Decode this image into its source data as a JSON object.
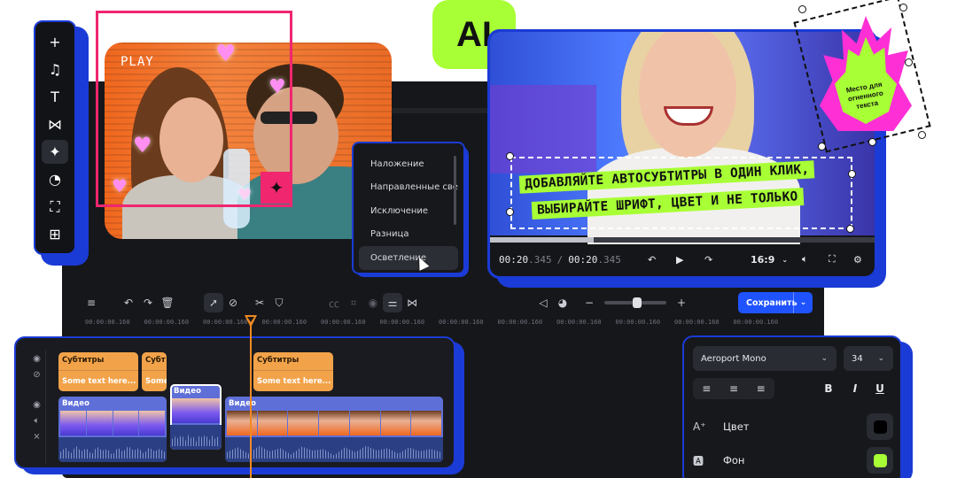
{
  "rail": {
    "tools": [
      {
        "icon": "plus-icon",
        "glyph": "+"
      },
      {
        "icon": "music-icon",
        "glyph": "♫"
      },
      {
        "icon": "text-icon",
        "glyph": "T"
      },
      {
        "icon": "transitions-icon",
        "glyph": "⋈"
      },
      {
        "icon": "magic-wand-icon",
        "glyph": "✦"
      },
      {
        "icon": "filters-icon",
        "glyph": "◔"
      },
      {
        "icon": "stickers-icon",
        "glyph": "⛶"
      },
      {
        "icon": "more-apps-icon",
        "glyph": "⊞"
      }
    ]
  },
  "photo": {
    "play_label": "PLAY"
  },
  "blend_menu": {
    "options": [
      "Наложение",
      "Направленные свет",
      "Исключение",
      "Разница",
      "Осветление"
    ],
    "hovered": "Осветление"
  },
  "ai_badge": "AI",
  "preview": {
    "subtitle_line1": "ДОБАВЛЯЙТЕ АВТОСУБТИТРЫ В ОДИН КЛИК,",
    "subtitle_line2": "ВЫБИРАЙТЕ ШРИФТ, ЦВЕТ И НЕ ТОЛЬКО",
    "sticker_text": "Место для огненного текста",
    "time_current_main": "00:20",
    "time_current_ms": ".345",
    "time_sep": "/",
    "time_total_main": "00:20",
    "time_total_ms": ".345",
    "aspect": "16:9",
    "progress": 0.27
  },
  "toolbar": {
    "save_label": "Сохранить"
  },
  "ruler": {
    "ticks": [
      "00:00:00.160",
      "00:00:00.160",
      "00:00:00.160",
      "00:00:00.160",
      "00:00:00.160",
      "00:00:00.160",
      "00:00:00.160",
      "00:00:00.160",
      "00:00:00.160",
      "00:00:00.160",
      "00:00:00.160",
      "00:00:00.160"
    ]
  },
  "timeline": {
    "sub_clips": [
      {
        "title": "Субтитры",
        "text": "Some text here... Some"
      },
      {
        "title": "Субт",
        "text": "Some"
      },
      {
        "title": "Субтитры",
        "text": "Some text here... Some"
      }
    ],
    "video_clips": [
      {
        "title": "Видео"
      },
      {
        "title": "Видео"
      },
      {
        "title": "Видео"
      }
    ]
  },
  "text_panel": {
    "font": "Aeroport Mono",
    "size": "34",
    "bold": "B",
    "italic": "I",
    "underline": "U",
    "color_label": "Цвет",
    "bg_label": "Фон",
    "color_value": "#000000",
    "bg_value": "#a8ff35"
  },
  "colors": {
    "accent_blue": "#1b3bd6",
    "accent_green": "#a8ff35",
    "accent_pink": "#f0266f",
    "playhead": "#f08a24",
    "save_button": "#1f53ff"
  }
}
